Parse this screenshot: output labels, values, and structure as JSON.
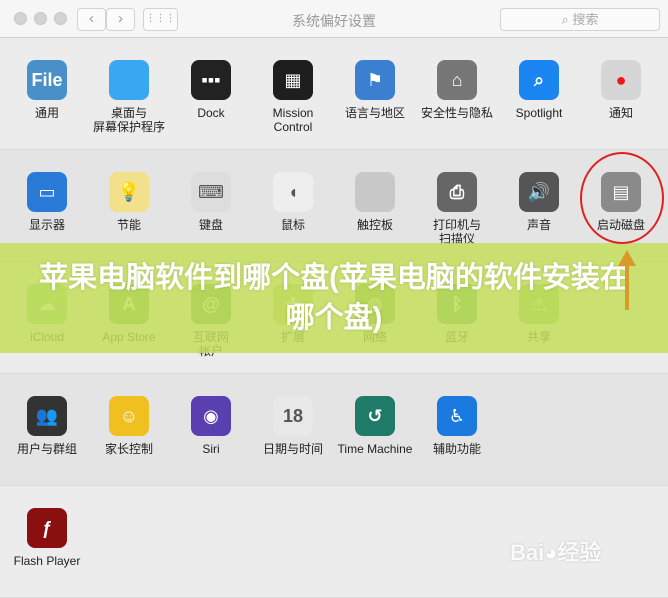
{
  "window": {
    "title": "系统偏好设置",
    "search_placeholder": "搜索",
    "back": "‹",
    "forward": "›",
    "grid": "⋮⋮⋮"
  },
  "rows": [
    [
      {
        "label": "通用",
        "icon": "general-icon",
        "color": "#4a90c8",
        "glyph": "File"
      },
      {
        "label": "桌面与\n屏幕保护程序",
        "icon": "desktop-icon",
        "color": "#3aa8f0",
        "glyph": ""
      },
      {
        "label": "Dock",
        "icon": "dock-icon",
        "color": "#222222",
        "glyph": "▪▪▪"
      },
      {
        "label": "Mission\nControl",
        "icon": "mission-control-icon",
        "color": "#1e1e1e",
        "glyph": "▦"
      },
      {
        "label": "语言与地区",
        "icon": "flag-icon",
        "color": "#3b7fd0",
        "glyph": "⚑"
      },
      {
        "label": "安全性与隐私",
        "icon": "security-icon",
        "color": "#777777",
        "glyph": "⌂"
      },
      {
        "label": "Spotlight",
        "icon": "spotlight-icon",
        "color": "#1a84f0",
        "glyph": "⌕"
      },
      {
        "label": "通知",
        "icon": "notification-icon",
        "color": "#d6d6d6",
        "glyph": "●"
      }
    ],
    [
      {
        "label": "显示器",
        "icon": "display-icon",
        "color": "#2a7ad8",
        "glyph": "▭"
      },
      {
        "label": "节能",
        "icon": "energy-icon",
        "color": "#f2e08a",
        "glyph": "💡"
      },
      {
        "label": "键盘",
        "icon": "keyboard-icon",
        "color": "#dddddd",
        "glyph": "⌨"
      },
      {
        "label": "鼠标",
        "icon": "mouse-icon",
        "color": "#eeeeee",
        "glyph": "◖"
      },
      {
        "label": "触控板",
        "icon": "trackpad-icon",
        "color": "#c8c8c8",
        "glyph": ""
      },
      {
        "label": "打印机与\n扫描仪",
        "icon": "printer-icon",
        "color": "#666666",
        "glyph": "⎙"
      },
      {
        "label": "声音",
        "icon": "sound-icon",
        "color": "#555555",
        "glyph": "🔊"
      },
      {
        "label": "启动磁盘",
        "icon": "startup-disk-icon",
        "color": "#8a8a8a",
        "glyph": "▤"
      }
    ],
    [
      {
        "label": "iCloud",
        "icon": "icloud-icon",
        "color": "#7fcf7a",
        "glyph": "☁"
      },
      {
        "label": "App Store",
        "icon": "app-store-icon",
        "color": "#5ab05a",
        "glyph": "A"
      },
      {
        "label": "互联网\n帐户",
        "icon": "internet-accounts-icon",
        "color": "#4aa050",
        "glyph": "@"
      },
      {
        "label": "扩展",
        "icon": "extensions-icon",
        "color": "#b0c870",
        "glyph": "✚"
      },
      {
        "label": "网络",
        "icon": "network-icon",
        "color": "#6aa050",
        "glyph": "◍"
      },
      {
        "label": "蓝牙",
        "icon": "bluetooth-icon",
        "color": "#4aa860",
        "glyph": "ᛒ"
      },
      {
        "label": "共享",
        "icon": "sharing-icon",
        "color": "#78c060",
        "glyph": "⚠"
      }
    ],
    [
      {
        "label": "用户与群组",
        "icon": "users-icon",
        "color": "#333333",
        "glyph": "👥"
      },
      {
        "label": "家长控制",
        "icon": "parental-controls-icon",
        "color": "#f0c020",
        "glyph": "☺"
      },
      {
        "label": "Siri",
        "icon": "siri-icon",
        "color": "#5a3fb0",
        "glyph": "◉"
      },
      {
        "label": "日期与时间",
        "icon": "date-time-icon",
        "color": "#e8e8e8",
        "glyph": "18"
      },
      {
        "label": "Time Machine",
        "icon": "time-machine-icon",
        "color": "#1f7a6a",
        "glyph": "↺"
      },
      {
        "label": "辅助功能",
        "icon": "accessibility-icon",
        "color": "#1a7ae0",
        "glyph": "♿"
      }
    ],
    [
      {
        "label": "Flash Player",
        "icon": "flash-player-icon",
        "color": "#8a1010",
        "glyph": "ƒ"
      }
    ]
  ],
  "overlay": {
    "text": "苹果电脑软件到哪个盘(苹果电脑的软件安装在哪个盘)"
  },
  "watermark": "Baidu经验"
}
